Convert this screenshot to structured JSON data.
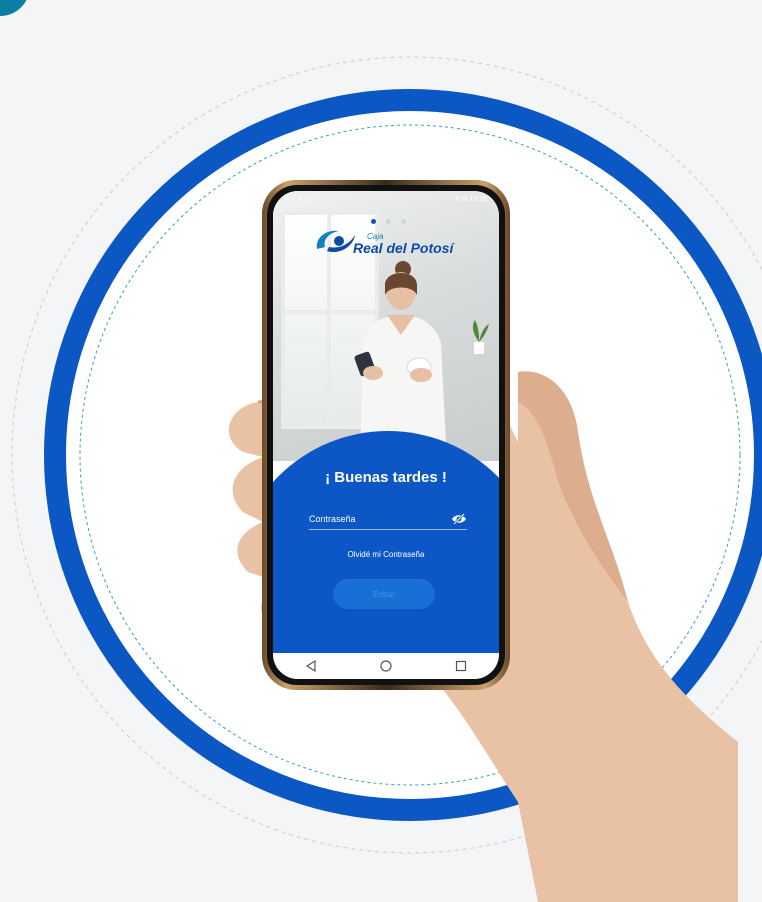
{
  "colors": {
    "brand_blue": "#0c57c5",
    "ring_blue": "#0b57c4",
    "accent_teal": "#0b7ea3",
    "button_blue": "#1a6fd4"
  },
  "app": {
    "status_time": "12:25",
    "status_battery": "9 %",
    "logo": {
      "line1": "Caja",
      "line2": "Real del Potosí"
    },
    "carousel": {
      "count": 3,
      "active_index": 0
    },
    "greeting": "¡ Buenas tardes !",
    "password": {
      "placeholder": "Contraseña",
      "value": ""
    },
    "icons": {
      "visibility_toggle": "eye-slash-icon",
      "nav_back": "back-triangle-icon",
      "nav_home": "home-circle-icon",
      "nav_recents": "recents-square-icon"
    },
    "forgot_link": "Olvidé mi Contraseña",
    "enter_button": "Entrar"
  }
}
